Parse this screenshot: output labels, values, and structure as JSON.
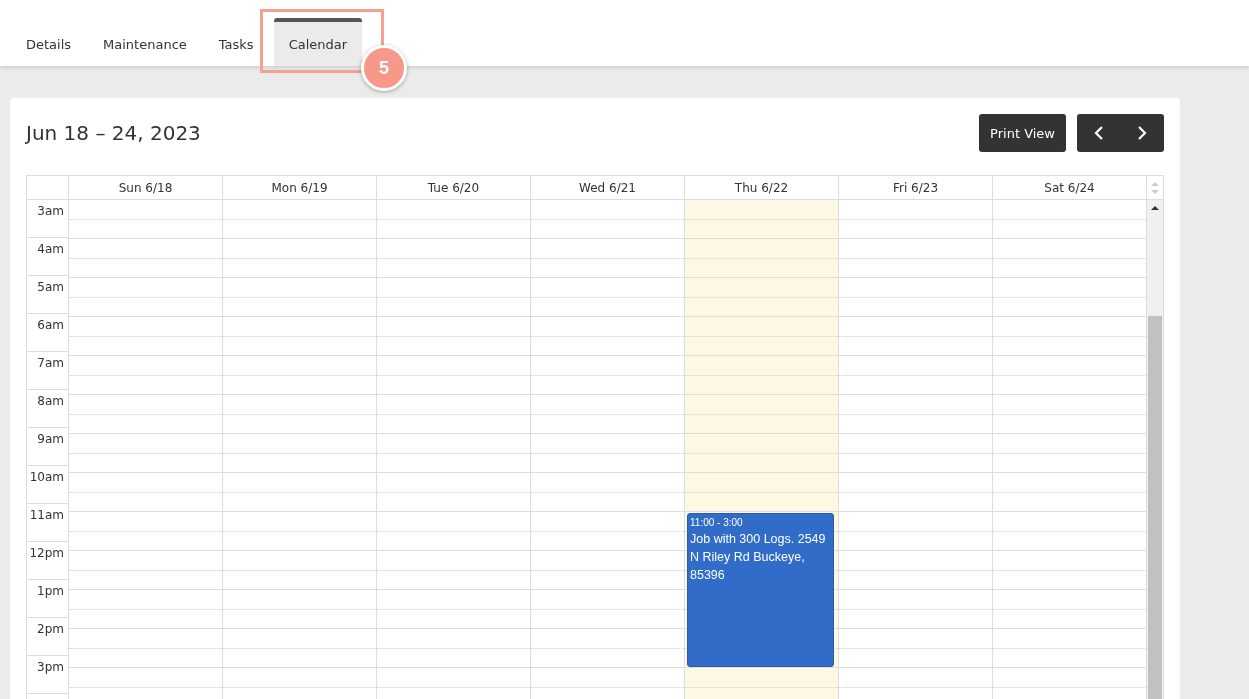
{
  "tabs": [
    {
      "label": "Details",
      "selected": false
    },
    {
      "label": "Maintenance",
      "selected": false
    },
    {
      "label": "Tasks",
      "selected": false
    },
    {
      "label": "Calendar",
      "selected": true
    }
  ],
  "step_badge": "5",
  "calendar": {
    "title": "Jun 18 – 24, 2023",
    "print_button": "Print View",
    "days": [
      {
        "label": "Sun 6/18",
        "today": false
      },
      {
        "label": "Mon 6/19",
        "today": false
      },
      {
        "label": "Tue 6/20",
        "today": false
      },
      {
        "label": "Wed 6/21",
        "today": false
      },
      {
        "label": "Thu 6/22",
        "today": true,
        "events": [
          {
            "time": "11:00 - 3:00",
            "title": "Job with 300 Logs. 2549 N Riley Rd Buckeye, 85396"
          }
        ]
      },
      {
        "label": "Fri 6/23",
        "today": false
      },
      {
        "label": "Sat 6/24",
        "today": false
      }
    ],
    "hours": [
      "3am",
      "4am",
      "5am",
      "6am",
      "7am",
      "8am",
      "9am",
      "10am",
      "11am",
      "12pm",
      "1pm",
      "2pm",
      "3pm"
    ]
  }
}
